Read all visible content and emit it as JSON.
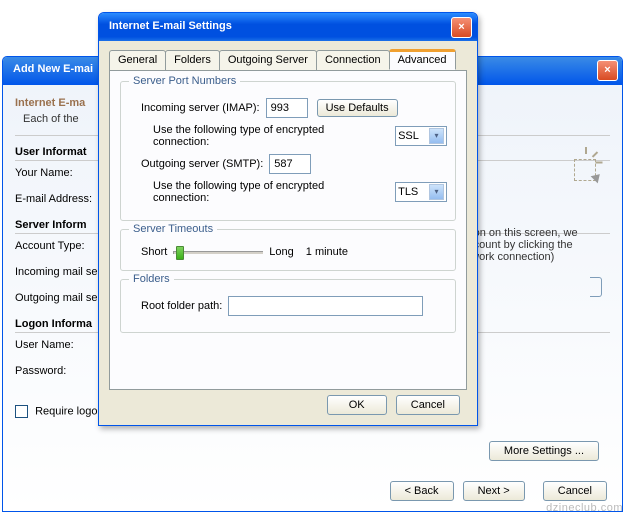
{
  "bgWindow": {
    "title": "Add New E-mai",
    "heading": "Internet E-ma",
    "subhead": "Each of the",
    "sections": {
      "userInfo": "User Informat",
      "serverInfo": "Server Inform",
      "logonInfo": "Logon Informa"
    },
    "fields": {
      "yourName": "Your Name:",
      "email": "E-mail Address:",
      "acctType": "Account Type:",
      "incoming": "Incoming mail se",
      "outgoing": "Outgoing mail se",
      "userName": "User Name:",
      "password": "Password:",
      "requireLogon": "Require logor"
    },
    "hint1": "ation on this screen, we",
    "hint2": "account by clicking the",
    "hint3": "etwork connection)",
    "moreSettings": "More Settings ...",
    "back": "< Back",
    "next": "Next >",
    "cancel": "Cancel"
  },
  "dialog": {
    "title": "Internet E-mail Settings",
    "tabs": {
      "general": "General",
      "folders": "Folders",
      "outgoing": "Outgoing Server",
      "connection": "Connection",
      "advanced": "Advanced"
    },
    "portNumbers": {
      "legend": "Server Port Numbers",
      "incomingLabel": "Incoming server (IMAP):",
      "incomingValue": "993",
      "useDefaults": "Use Defaults",
      "encLabel": "Use the following type of encrypted connection:",
      "incomingEnc": "SSL",
      "outgoingLabel": "Outgoing server (SMTP):",
      "outgoingValue": "587",
      "outgoingEnc": "TLS"
    },
    "timeouts": {
      "legend": "Server Timeouts",
      "short": "Short",
      "long": "Long",
      "value": "1 minute"
    },
    "folders": {
      "legend": "Folders",
      "rootLabel": "Root folder path:",
      "rootValue": ""
    },
    "ok": "OK",
    "cancel": "Cancel"
  },
  "watermark": "dzineclub.com"
}
